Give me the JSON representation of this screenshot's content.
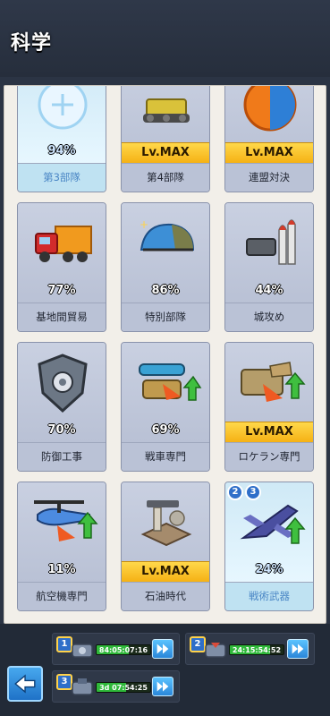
{
  "header": {
    "title": "科学"
  },
  "cards": [
    {
      "label": "第3部隊",
      "percent": "94%",
      "status": "active",
      "icon": "troop-icon"
    },
    {
      "label": "第4部隊",
      "maxLabel": "Lv.MAX",
      "status": "max",
      "icon": "bulldozer-icon"
    },
    {
      "label": "連盟対決",
      "maxLabel": "Lv.MAX",
      "status": "max",
      "icon": "versus-icon"
    },
    {
      "label": "基地間貿易",
      "percent": "77%",
      "status": "normal",
      "icon": "truck-icon"
    },
    {
      "label": "特別部隊",
      "percent": "86%",
      "status": "normal",
      "icon": "helmet-icon"
    },
    {
      "label": "城攻め",
      "percent": "44%",
      "status": "normal",
      "icon": "missiles-icon"
    },
    {
      "label": "防御工事",
      "percent": "70%",
      "status": "normal",
      "icon": "shield-gear-icon"
    },
    {
      "label": "戦車専門",
      "percent": "69%",
      "status": "normal",
      "icon": "tank-icon"
    },
    {
      "label": "ロケラン専門",
      "maxLabel": "Lv.MAX",
      "status": "max",
      "icon": "rocket-launcher-icon"
    },
    {
      "label": "航空機専門",
      "percent": "11%",
      "status": "normal",
      "icon": "helicopter-icon"
    },
    {
      "label": "石油時代",
      "maxLabel": "Lv.MAX",
      "status": "max",
      "icon": "oil-pump-icon"
    },
    {
      "label": "戦術武器",
      "percent": "24%",
      "status": "active",
      "icon": "jet-icon",
      "badges": [
        "2",
        "3"
      ]
    }
  ],
  "queues": [
    {
      "num": "1",
      "timer": "84:05:07:16",
      "progress": 0.6
    },
    {
      "num": "2",
      "timer": "24:15:54:52",
      "progress": 0.75
    },
    {
      "num": "3",
      "timer": "3d 07:54:25",
      "progress": 0.55
    }
  ],
  "colors": {
    "accent": "#2f6fc9",
    "max_gold": "#f5b114",
    "active_blue": "#bfe6f7",
    "timer_green": "#2fb83a"
  }
}
